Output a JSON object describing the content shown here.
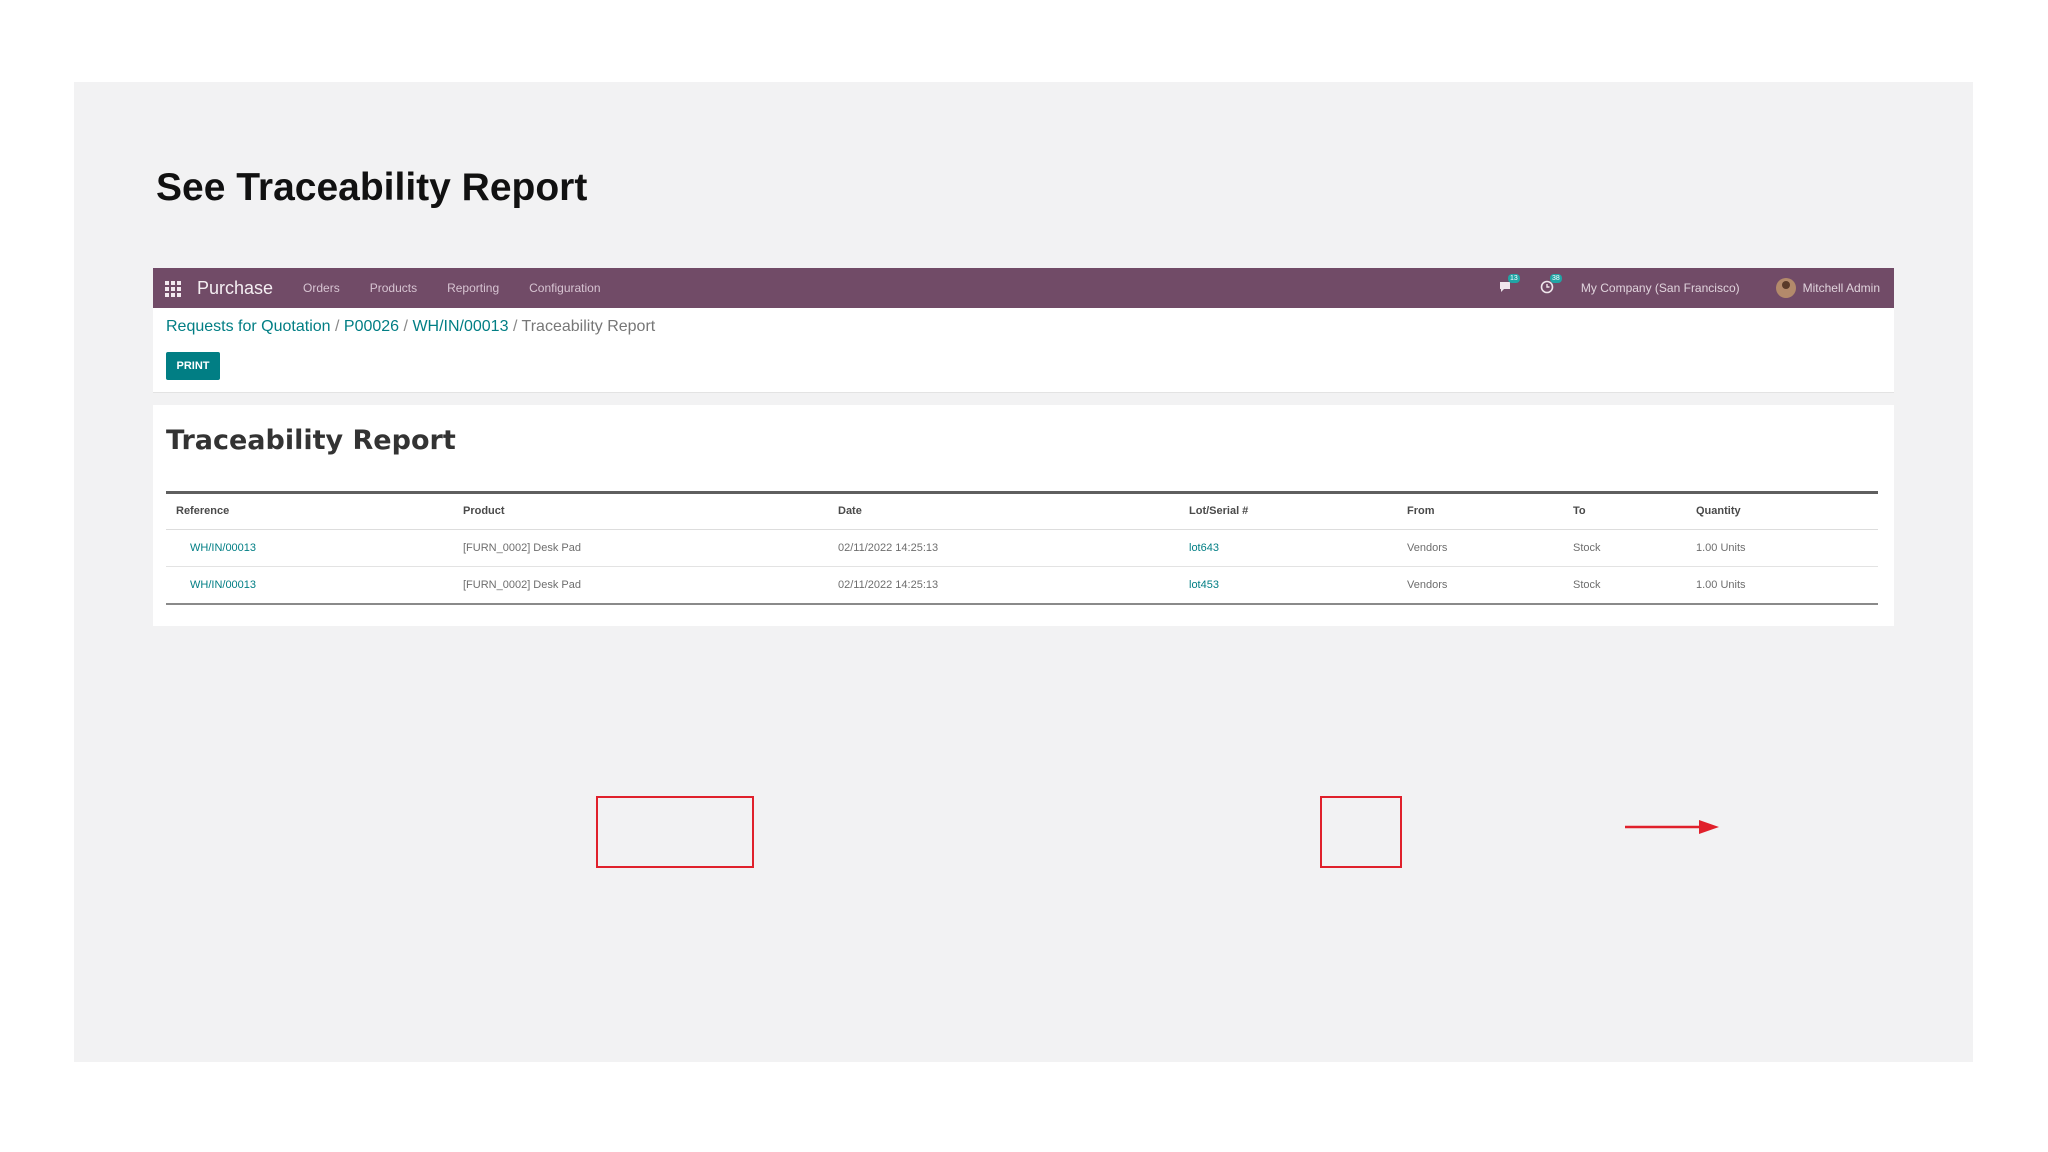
{
  "slide": {
    "title": "See Traceability Report"
  },
  "navbar": {
    "app_name": "Purchase",
    "menu": [
      "Orders",
      "Products",
      "Reporting",
      "Configuration"
    ],
    "messages_badge": "13",
    "activities_badge": "38",
    "company": "My Company (San Francisco)",
    "user": "Mitchell Admin"
  },
  "breadcrumb": {
    "items": [
      "Requests for Quotation",
      "P00026",
      "WH/IN/00013"
    ],
    "current": "Traceability Report",
    "separator": "/"
  },
  "print_label": "PRINT",
  "report": {
    "title": "Traceability Report",
    "columns": [
      "Reference",
      "Product",
      "Date",
      "Lot/Serial #",
      "From",
      "To",
      "Quantity"
    ],
    "rows": [
      [
        "WH/IN/00013",
        "[FURN_0002] Desk Pad",
        "02/11/2022 14:25:13",
        "lot643",
        "Vendors",
        "Stock",
        "1.00 Units"
      ],
      [
        "WH/IN/00013",
        "[FURN_0002] Desk Pad",
        "02/11/2022 14:25:13",
        "lot453",
        "Vendors",
        "Stock",
        "1.00 Units"
      ]
    ]
  },
  "colors": {
    "navbar": "#714b67",
    "link": "#017e84",
    "highlight": "#e0202b",
    "slide_background": "#f2f2f3"
  },
  "icons": {
    "apps": "apps-grid-icon",
    "messages": "chat-icon",
    "activities": "clock-icon",
    "annotation": "arrow-right-icon"
  }
}
